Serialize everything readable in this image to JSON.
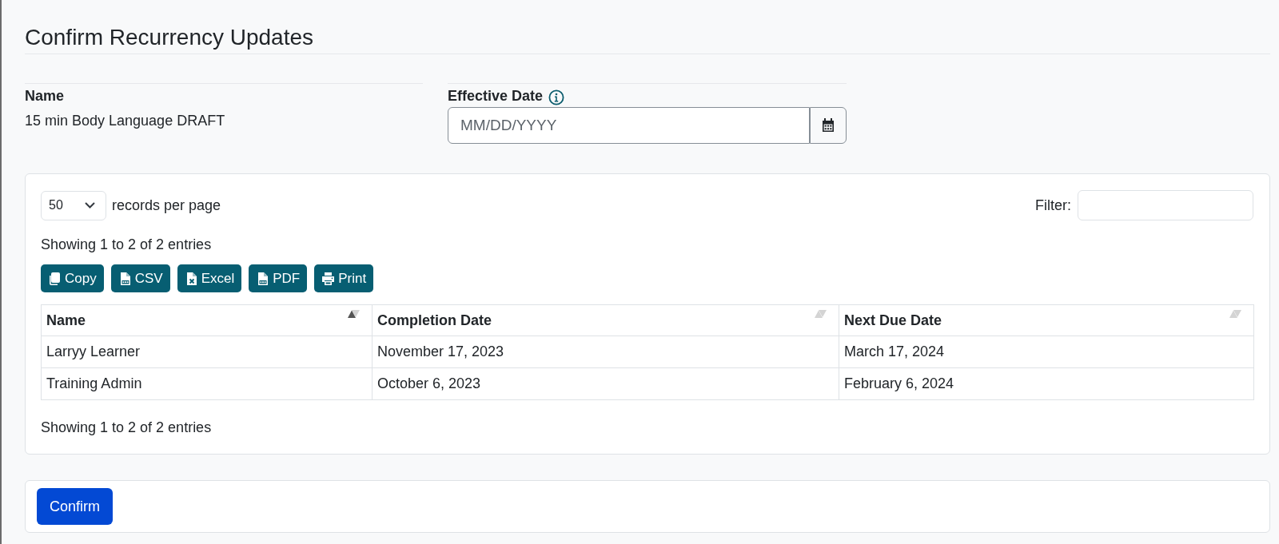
{
  "page": {
    "title": "Confirm Recurrency Updates"
  },
  "details": {
    "name": {
      "label": "Name",
      "value": "15 min Body Language DRAFT"
    },
    "effective_date": {
      "label": "Effective Date",
      "placeholder": "MM/DD/YYYY"
    }
  },
  "records_card": {
    "page_size": {
      "value": "50",
      "label": "records per page"
    },
    "filter": {
      "label": "Filter:"
    },
    "info_top": "Showing 1 to 2 of 2 entries",
    "export_buttons": [
      {
        "kind": "copy",
        "label": "Copy"
      },
      {
        "kind": "csv",
        "label": "CSV"
      },
      {
        "kind": "excel",
        "label": "Excel"
      },
      {
        "kind": "pdf",
        "label": "PDF"
      },
      {
        "kind": "print",
        "label": "Print"
      }
    ],
    "table": {
      "columns": [
        {
          "label": "Name",
          "sorted": true
        },
        {
          "label": "Completion Date",
          "sorted": false
        },
        {
          "label": "Next Due Date",
          "sorted": false
        }
      ],
      "rows": [
        [
          "Larryy Learner",
          "November 17, 2023",
          "March 17, 2024"
        ],
        [
          "Training Admin",
          "October 6, 2023",
          "February 6, 2024"
        ]
      ]
    },
    "info_bottom": "Showing 1 to 2 of 2 entries"
  },
  "actions": {
    "buttons": [
      {
        "label": "Confirm"
      }
    ]
  }
}
